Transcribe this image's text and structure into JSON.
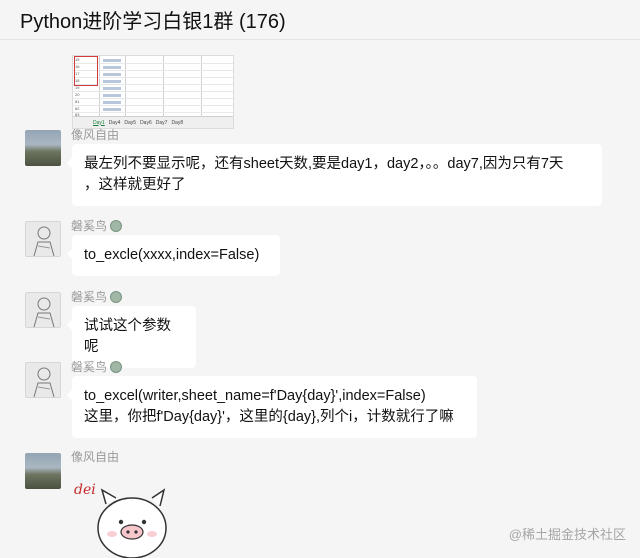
{
  "header": {
    "title": "Python进阶学习白银1群 (176)"
  },
  "thumbnail": {
    "rows": [
      "15",
      "16",
      "17",
      "18",
      "19",
      "20",
      "81",
      "82",
      "83"
    ],
    "tabs": [
      "Day1",
      "Day4",
      "Day5",
      "Day6",
      "Day7",
      "Day8"
    ]
  },
  "messages": [
    {
      "nickname": "像风自由",
      "avatar": "landscape-avatar",
      "lines": [
        "最左列不要显示呢，还有sheet天数,要是day1，day2，。。day7,因为只有7天",
        "，这样就更好了"
      ]
    },
    {
      "nickname": "磐奚鸟",
      "avatar": "sketch-avatar",
      "lines": [
        "to_excle(xxxx,index=False)"
      ]
    },
    {
      "nickname": "磐奚鸟",
      "avatar": "sketch-avatar",
      "lines": [
        "试试这个参数呢"
      ]
    },
    {
      "nickname": "磐奚鸟",
      "avatar": "sketch-avatar",
      "lines": [
        "to_excel(writer,sheet_name=f'Day{day}',index=False)",
        "这里，你把f'Day{day}'，这里的{day},列个i，计数就行了嘛"
      ]
    },
    {
      "nickname": "像风自由",
      "avatar": "landscape-avatar",
      "sticker_text": "dei"
    }
  ],
  "watermark": "@稀土掘金技术社区",
  "colors": {
    "background": "#f5f5f5",
    "bubble": "#ffffff",
    "nickname": "#999999",
    "sticker_text": "#c42a2a"
  }
}
